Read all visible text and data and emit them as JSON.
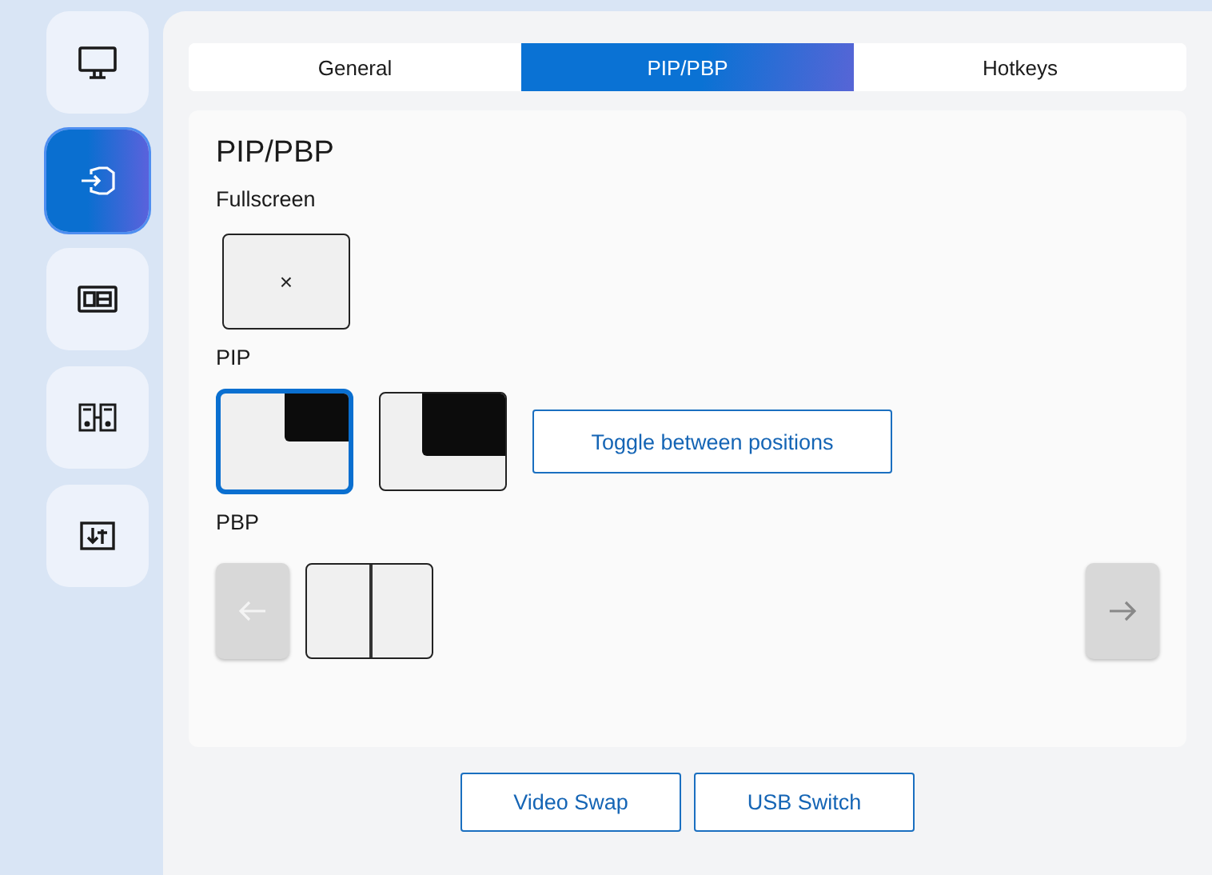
{
  "sidebar": {
    "items": [
      {
        "selected": false
      },
      {
        "selected": true
      },
      {
        "selected": false
      },
      {
        "selected": false
      },
      {
        "selected": false
      }
    ]
  },
  "tabs": [
    {
      "label": "General",
      "selected": false
    },
    {
      "label": "PIP/PBP",
      "selected": true
    },
    {
      "label": "Hotkeys",
      "selected": false
    }
  ],
  "panel": {
    "title": "PIP/PBP",
    "fullscreen": {
      "label": "Fullscreen",
      "tile_mark": "×"
    },
    "pip": {
      "label": "PIP",
      "tiles": [
        {
          "selected": true
        },
        {
          "selected": false
        }
      ],
      "toggle_button": "Toggle between positions"
    },
    "pbp": {
      "label": "PBP",
      "prev_disabled": true,
      "next_disabled": true
    }
  },
  "buttons": [
    "Video Swap",
    "USB Switch"
  ]
}
